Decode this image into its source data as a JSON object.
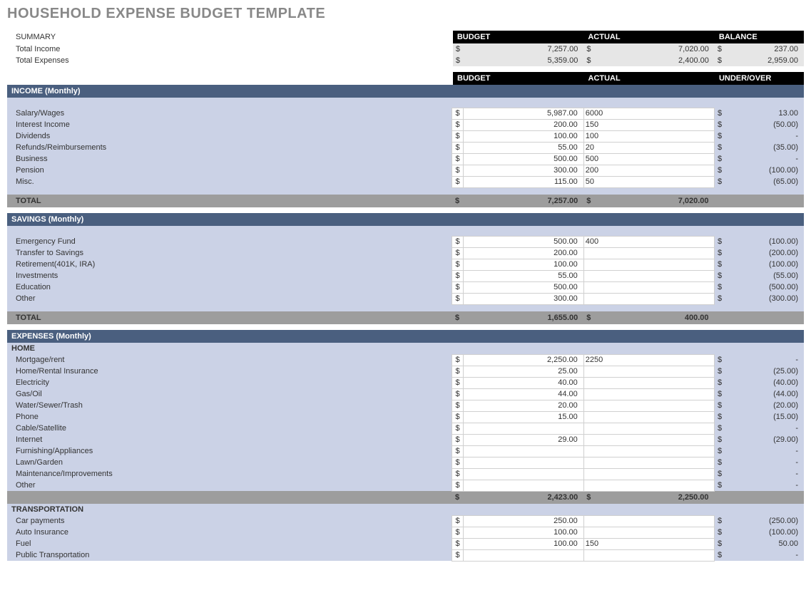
{
  "title": "HOUSEHOLD EXPENSE BUDGET TEMPLATE",
  "headers": {
    "summary_budget": "BUDGET",
    "summary_actual": "ACTUAL",
    "summary_balance": "BALANCE",
    "col_budget": "BUDGET",
    "col_actual": "ACTUAL",
    "col_under_over": "UNDER/OVER"
  },
  "summary": {
    "title": "SUMMARY",
    "rows": [
      {
        "label": "Total Income",
        "budget": "7,257.00",
        "actual": "7,020.00",
        "balance": "237.00"
      },
      {
        "label": "Total Expenses",
        "budget": "5,359.00",
        "actual": "2,400.00",
        "balance": "2,959.00"
      }
    ]
  },
  "sections": [
    {
      "title": "INCOME (Monthly)",
      "rows": [
        {
          "label": "Salary/Wages",
          "budget": "5,987.00",
          "actual": "6000",
          "uo": "13.00"
        },
        {
          "label": "Interest Income",
          "budget": "200.00",
          "actual": "150",
          "uo": "(50.00)"
        },
        {
          "label": "Dividends",
          "budget": "100.00",
          "actual": "100",
          "uo": "-"
        },
        {
          "label": "Refunds/Reimbursements",
          "budget": "55.00",
          "actual": "20",
          "uo": "(35.00)"
        },
        {
          "label": "Business",
          "budget": "500.00",
          "actual": "500",
          "uo": "-"
        },
        {
          "label": "Pension",
          "budget": "300.00",
          "actual": "200",
          "uo": "(100.00)"
        },
        {
          "label": "Misc.",
          "budget": "115.00",
          "actual": "50",
          "uo": "(65.00)"
        }
      ],
      "total": {
        "label": "TOTAL",
        "budget": "7,257.00",
        "actual": "7,020.00"
      }
    },
    {
      "title": "SAVINGS (Monthly)",
      "rows": [
        {
          "label": "Emergency Fund",
          "budget": "500.00",
          "actual": "400",
          "uo": "(100.00)"
        },
        {
          "label": "Transfer to Savings",
          "budget": "200.00",
          "actual": "",
          "uo": "(200.00)"
        },
        {
          "label": "Retirement(401K, IRA)",
          "budget": "100.00",
          "actual": "",
          "uo": "(100.00)"
        },
        {
          "label": "Investments",
          "budget": "55.00",
          "actual": "",
          "uo": "(55.00)"
        },
        {
          "label": "Education",
          "budget": "500.00",
          "actual": "",
          "uo": "(500.00)"
        },
        {
          "label": "Other",
          "budget": "300.00",
          "actual": "",
          "uo": "(300.00)"
        }
      ],
      "total": {
        "label": "TOTAL",
        "budget": "1,655.00",
        "actual": "400.00"
      }
    },
    {
      "title": "EXPENSES (Monthly)",
      "groups": [
        {
          "name": "HOME",
          "rows": [
            {
              "label": "Mortgage/rent",
              "budget": "2,250.00",
              "actual": "2250",
              "uo": "-"
            },
            {
              "label": "Home/Rental Insurance",
              "budget": "25.00",
              "actual": "",
              "uo": "(25.00)"
            },
            {
              "label": "Electricity",
              "budget": "40.00",
              "actual": "",
              "uo": "(40.00)"
            },
            {
              "label": "Gas/Oil",
              "budget": "44.00",
              "actual": "",
              "uo": "(44.00)"
            },
            {
              "label": "Water/Sewer/Trash",
              "budget": "20.00",
              "actual": "",
              "uo": "(20.00)"
            },
            {
              "label": "Phone",
              "budget": "15.00",
              "actual": "",
              "uo": "(15.00)"
            },
            {
              "label": "Cable/Satellite",
              "budget": "",
              "actual": "",
              "uo": "-"
            },
            {
              "label": "Internet",
              "budget": "29.00",
              "actual": "",
              "uo": "(29.00)"
            },
            {
              "label": "Furnishing/Appliances",
              "budget": "",
              "actual": "",
              "uo": "-"
            },
            {
              "label": "Lawn/Garden",
              "budget": "",
              "actual": "",
              "uo": "-"
            },
            {
              "label": "Maintenance/Improvements",
              "budget": "",
              "actual": "",
              "uo": "-"
            },
            {
              "label": "Other",
              "budget": "",
              "actual": "",
              "uo": "-"
            }
          ],
          "subtotal": {
            "budget": "2,423.00",
            "actual": "2,250.00"
          }
        },
        {
          "name": "TRANSPORTATION",
          "rows": [
            {
              "label": "Car payments",
              "budget": "250.00",
              "actual": "",
              "uo": "(250.00)"
            },
            {
              "label": "Auto Insurance",
              "budget": "100.00",
              "actual": "",
              "uo": "(100.00)"
            },
            {
              "label": "Fuel",
              "budget": "100.00",
              "actual": "150",
              "uo": "50.00"
            },
            {
              "label": "Public Transportation",
              "budget": "",
              "actual": "",
              "uo": "-"
            }
          ]
        }
      ]
    }
  ],
  "cur": "$"
}
